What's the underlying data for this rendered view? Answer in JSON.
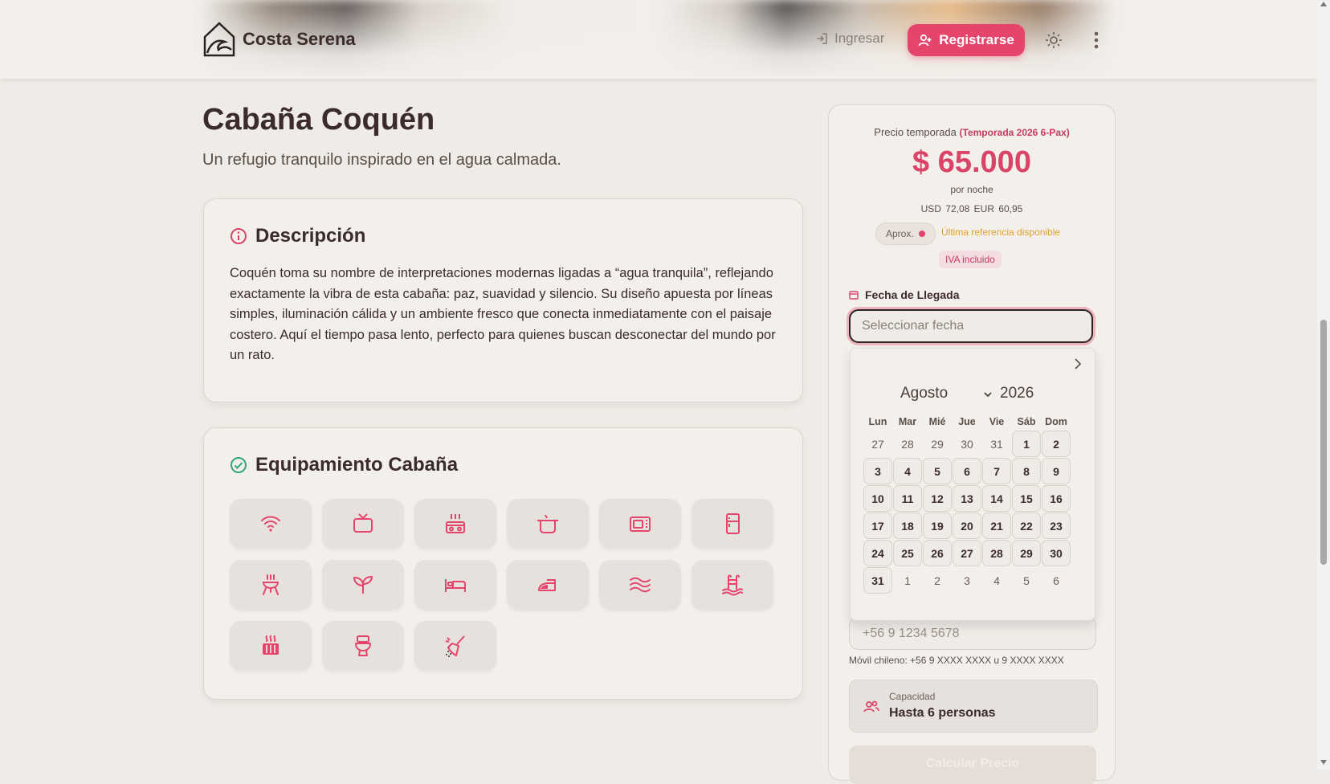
{
  "brand": {
    "name": "Costa Serena"
  },
  "nav": {
    "login": "Ingresar",
    "register": "Registrarse"
  },
  "page": {
    "title": "Cabaña Coquén",
    "subtitle": "Un refugio tranquilo inspirado en el agua calmada."
  },
  "description": {
    "heading": "Descripción",
    "text": "Coquén toma su nombre de interpretaciones modernas ligadas a “agua tranquila”, reflejando exactamente la vibra de esta cabaña: paz, suavidad y silencio. Su diseño apuesta por líneas simples, iluminación cálida y un ambiente fresco que conecta inmediatamente con el paisaje costero. Aquí el tiempo pasa lento, perfecto para quienes buscan desconectar del mundo por un rato."
  },
  "equipment": {
    "heading": "Equipamiento Cabaña",
    "items": [
      {
        "icon": "wifi-icon"
      },
      {
        "icon": "tv-icon"
      },
      {
        "icon": "stove-icon"
      },
      {
        "icon": "cooking-pot-icon"
      },
      {
        "icon": "microwave-icon"
      },
      {
        "icon": "refrigerator-icon"
      },
      {
        "icon": "grill-icon"
      },
      {
        "icon": "plant-icon"
      },
      {
        "icon": "bed-icon"
      },
      {
        "icon": "iron-icon"
      },
      {
        "icon": "waves-icon"
      },
      {
        "icon": "pool-ladder-icon"
      },
      {
        "icon": "heater-icon"
      },
      {
        "icon": "toilet-icon"
      },
      {
        "icon": "cleaning-icon"
      }
    ]
  },
  "booking": {
    "season_label": "Precio temporada",
    "season_name": "(Temporada 2026 6-Pax)",
    "price": "$ 65.000",
    "per_night": "por noche",
    "fx": "USD 72,08   EUR 60,95",
    "aprox": "Aprox.",
    "reference": "Última referencia disponible",
    "iva": "IVA incluido",
    "arrival_label": "Fecha de Llegada",
    "arrival_placeholder": "Seleccionar fecha",
    "phone_placeholder": "+56 9 1234 5678",
    "phone_hint": "Móvil chileno: +56 9 XXXX XXXX u 9 XXXX XXXX",
    "capacity_label": "Capacidad",
    "capacity_value": "Hasta 6 personas",
    "calc_button": "Calcular Precio"
  },
  "calendar": {
    "month": "Agosto",
    "year": "2026",
    "weekdays": [
      "Lun",
      "Mar",
      "Mié",
      "Jue",
      "Vie",
      "Sáb",
      "Dom"
    ],
    "weeks": [
      [
        "27",
        "28",
        "29",
        "30",
        "31",
        "1",
        "2"
      ],
      [
        "3",
        "4",
        "5",
        "6",
        "7",
        "8",
        "9"
      ],
      [
        "10",
        "11",
        "12",
        "13",
        "14",
        "15",
        "16"
      ],
      [
        "17",
        "18",
        "19",
        "20",
        "21",
        "22",
        "23"
      ],
      [
        "24",
        "25",
        "26",
        "27",
        "28",
        "29",
        "30"
      ],
      [
        "31",
        "1",
        "2",
        "3",
        "4",
        "5",
        "6"
      ]
    ]
  },
  "colors": {
    "accent": "#e5456a",
    "background": "#efebe6",
    "success": "#2fa77a",
    "warning": "#e0a12c"
  }
}
